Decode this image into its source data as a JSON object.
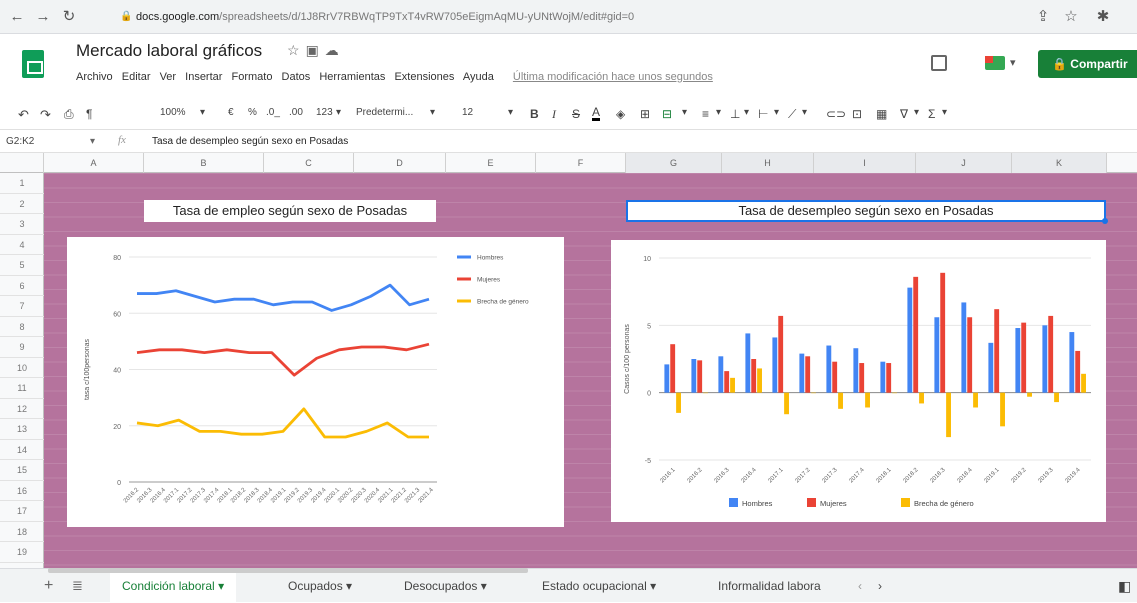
{
  "browser": {
    "url_host": "docs.google.com",
    "url_path": "/spreadsheets/d/1J8RrV7RBWqTP9TxT4vRW705eEigmAqMU-yUNtWojM/edit#gid=0"
  },
  "app": {
    "doc_title": "Mercado laboral gráficos",
    "menu": [
      "Archivo",
      "Editar",
      "Ver",
      "Insertar",
      "Formato",
      "Datos",
      "Herramientas",
      "Extensiones",
      "Ayuda"
    ],
    "last_edit": "Última modificación hace unos segundos",
    "share_label": "Compartir"
  },
  "toolbar": {
    "zoom": "100%",
    "currency": "€",
    "percent": "%",
    "decimal_less": ".0_",
    "decimal_more": ".00",
    "number_format": "123",
    "font": "Predetermi...",
    "font_size": "12",
    "bold": "B",
    "italic": "I",
    "strike": "S",
    "text_color": "A"
  },
  "formula_bar": {
    "cell_ref": "G2:K2",
    "fx": "fx",
    "content": "Tasa de desempleo según sexo en Posadas"
  },
  "grid": {
    "columns": [
      "A",
      "B",
      "C",
      "D",
      "E",
      "F",
      "G",
      "H",
      "I",
      "J",
      "K"
    ],
    "rows": [
      "1",
      "2",
      "3",
      "4",
      "5",
      "6",
      "7",
      "8",
      "9",
      "10",
      "11",
      "12",
      "13",
      "14",
      "15",
      "16",
      "17",
      "18",
      "19"
    ]
  },
  "chart1": {
    "title": "Tasa de empleo según sexo de Posadas"
  },
  "chart2": {
    "title": "Tasa de desempleo según sexo en Posadas"
  },
  "chart_data": [
    {
      "type": "line",
      "title": "Tasa de empleo según sexo de Posadas",
      "ylabel": "tasa c/100personas",
      "ylim": [
        0,
        80
      ],
      "yticks": [
        0,
        20,
        40,
        60,
        80
      ],
      "categories": [
        "2016.2",
        "2016.3",
        "2016.4",
        "2017.1",
        "2017.2",
        "2017.3",
        "2017.4",
        "2018.1",
        "2018.2",
        "2018.3",
        "2018.4",
        "2019.1",
        "2019.2",
        "2019.3",
        "2019.4",
        "2020.1",
        "2020.2",
        "2020.3",
        "2020.4",
        "2021.1",
        "2021.2",
        "2021.3",
        "2021.4"
      ],
      "series": [
        {
          "name": "Hombres",
          "color": "#4285f4",
          "values": [
            67,
            67,
            68,
            66,
            64,
            65,
            65,
            63,
            64,
            64,
            61,
            63,
            66,
            70,
            63,
            65
          ]
        },
        {
          "name": "Mujeres",
          "color": "#ea4335",
          "values": [
            46,
            47,
            47,
            46,
            47,
            46,
            46,
            38,
            44,
            47,
            48,
            48,
            47,
            49
          ]
        },
        {
          "name": "Brecha de género",
          "color": "#fbbc04",
          "values": [
            21,
            20,
            22,
            18,
            18,
            17,
            17,
            18,
            26,
            16,
            16,
            18,
            21,
            16,
            16
          ]
        }
      ],
      "legend": "right"
    },
    {
      "type": "bar",
      "title": "Tasa de desempleo según sexo en Posadas",
      "ylabel": "Casos c/100 personas",
      "ylim": [
        -5,
        10
      ],
      "yticks": [
        -5,
        0,
        5,
        10
      ],
      "categories": [
        "2016.1",
        "2016.2",
        "2016.3",
        "2016.4",
        "2017.1",
        "2017.2",
        "2017.3",
        "2017.4",
        "2018.1",
        "2018.2",
        "2018.3",
        "2018.4",
        "2019.1",
        "2019.2",
        "2019.3",
        "2019.4"
      ],
      "series": [
        {
          "name": "Hombres",
          "color": "#4285f4",
          "values": [
            2.1,
            2.5,
            2.7,
            4.4,
            4.1,
            2.9,
            3.5,
            3.3,
            2.3,
            7.8,
            5.6,
            6.7,
            3.7,
            4.8,
            5.0,
            4.5
          ]
        },
        {
          "name": "Mujeres",
          "color": "#ea4335",
          "values": [
            3.6,
            2.4,
            1.6,
            2.5,
            5.7,
            2.7,
            2.3,
            2.2,
            2.2,
            8.6,
            8.9,
            5.6,
            6.2,
            5.2,
            5.7,
            3.1
          ]
        },
        {
          "name": "Brecha de género",
          "color": "#fbbc04",
          "values": [
            -1.5,
            0.0,
            1.1,
            1.8,
            -1.6,
            0.0,
            -1.2,
            -1.1,
            0.0,
            -0.8,
            -3.3,
            -1.1,
            -2.5,
            -0.3,
            -0.7,
            1.4
          ]
        }
      ],
      "legend": "bottom"
    }
  ],
  "tabs": [
    {
      "label": "Condición laboral",
      "active": true
    },
    {
      "label": "Ocupados",
      "active": false
    },
    {
      "label": "Desocupados",
      "active": false
    },
    {
      "label": "Estado ocupacional",
      "active": false
    },
    {
      "label": "Informalidad labora",
      "active": false
    }
  ]
}
